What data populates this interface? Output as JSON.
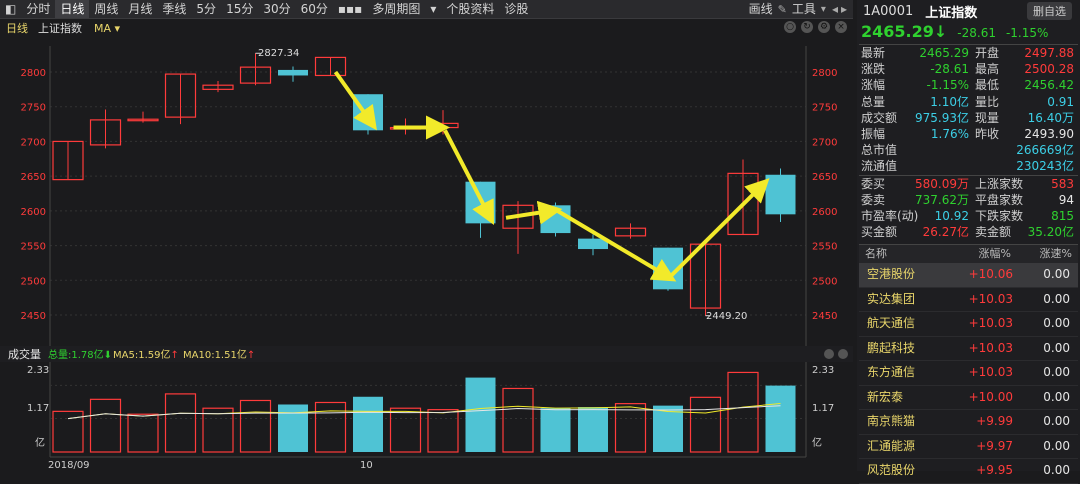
{
  "toolbar": {
    "items": [
      "分时",
      "日线",
      "周线",
      "月线",
      "季线",
      "5分",
      "15分",
      "30分",
      "60分",
      "▪▪▪",
      "多周期图",
      "▾",
      "个股资料",
      "诊股"
    ],
    "active_index": 1,
    "right_items": [
      "画线",
      "工具"
    ]
  },
  "subbar": {
    "label": "日线",
    "name": "上证指数",
    "ma": "MA"
  },
  "price_axis": [
    "2800",
    "2750",
    "2700",
    "2650",
    "2600",
    "2550",
    "2500",
    "2450"
  ],
  "annotations": {
    "high": "2827.34",
    "low": "2449.20"
  },
  "volume": {
    "title": "成交量",
    "total": "总量:1.78亿",
    "ma5": "MA5:1.59亿",
    "ma10": "MA10:1.51亿",
    "axis_top": "2.33",
    "axis_mid": "1.17",
    "axis_unit": "亿"
  },
  "xaxis": {
    "label1": "2018/09",
    "label2": "10"
  },
  "chart_data": {
    "type": "candlestick",
    "ylim": [
      2420,
      2840
    ],
    "candles": [
      {
        "o": 2645,
        "c": 2700,
        "h": 2700,
        "l": 2645
      },
      {
        "o": 2695,
        "c": 2731,
        "h": 2746,
        "l": 2690
      },
      {
        "o": 2730,
        "c": 2732,
        "h": 2743,
        "l": 2727
      },
      {
        "o": 2735,
        "c": 2797,
        "h": 2797,
        "l": 2725
      },
      {
        "o": 2775,
        "c": 2781,
        "h": 2787,
        "l": 2771
      },
      {
        "o": 2784,
        "c": 2807,
        "h": 2827,
        "l": 2781
      },
      {
        "o": 2803,
        "c": 2795,
        "h": 2808,
        "l": 2786
      },
      {
        "o": 2795,
        "c": 2821,
        "h": 2821,
        "l": 2795
      },
      {
        "o": 2768,
        "c": 2716,
        "h": 2768,
        "l": 2710
      },
      {
        "o": 2718,
        "c": 2720,
        "h": 2733,
        "l": 2710
      },
      {
        "o": 2720,
        "c": 2726,
        "h": 2745,
        "l": 2710
      },
      {
        "o": 2642,
        "c": 2582,
        "h": 2642,
        "l": 2561
      },
      {
        "o": 2575,
        "c": 2608,
        "h": 2614,
        "l": 2538
      },
      {
        "o": 2608,
        "c": 2568,
        "h": 2612,
        "l": 2563
      },
      {
        "o": 2560,
        "c": 2545,
        "h": 2566,
        "l": 2536
      },
      {
        "o": 2564,
        "c": 2575,
        "h": 2582,
        "l": 2560
      },
      {
        "o": 2547,
        "c": 2487,
        "h": 2547,
        "l": 2485
      },
      {
        "o": 2460,
        "c": 2552,
        "h": 2552,
        "l": 2449
      },
      {
        "o": 2566,
        "c": 2654,
        "h": 2674,
        "l": 2566
      },
      {
        "o": 2652,
        "c": 2595,
        "h": 2661,
        "l": 2584
      }
    ],
    "volumes": [
      1.42,
      1.84,
      1.32,
      2.03,
      1.53,
      1.8,
      1.66,
      1.73,
      1.93,
      1.53,
      1.48,
      2.6,
      2.22,
      1.53,
      1.57,
      1.69,
      1.62,
      1.91,
      2.78,
      2.32
    ],
    "vol_ylim": [
      0,
      2.9
    ]
  },
  "stock": {
    "code": "1A0001",
    "name": "上证指数",
    "delete_label": "删自选",
    "price": "2465.29",
    "arrow": "↓",
    "change": "-28.61",
    "change_pct": "-1.15%"
  },
  "quote": {
    "row1": [
      "最新",
      "2465.29",
      "开盘",
      "2497.88"
    ],
    "row2": [
      "涨跌",
      "-28.61",
      "最高",
      "2500.28"
    ],
    "row3": [
      "涨幅",
      "-1.15%",
      "最低",
      "2456.42"
    ],
    "row4": [
      "总量",
      "1.10亿",
      "量比",
      "0.91"
    ],
    "row5": [
      "成交额",
      "975.93亿",
      "现量",
      "16.40万"
    ],
    "row6": [
      "振幅",
      "1.76%",
      "昨收",
      "2493.90"
    ],
    "row7": [
      "总市值",
      "266669亿"
    ],
    "row8": [
      "流通值",
      "230243亿"
    ],
    "row9": [
      "委买",
      "580.09万",
      "上涨家数",
      "583"
    ],
    "row10": [
      "委卖",
      "737.62万",
      "平盘家数",
      "94"
    ],
    "row11": [
      "市盈率(动)",
      "10.92",
      "下跌家数",
      "815"
    ],
    "row12": [
      "买金额",
      "26.27亿",
      "卖金额",
      "35.20亿"
    ]
  },
  "list": {
    "headers": [
      "名称",
      "涨幅%",
      "涨速%"
    ],
    "rows": [
      {
        "name": "空港股份",
        "pct": "+10.06",
        "speed": "0.00"
      },
      {
        "name": "实达集团",
        "pct": "+10.03",
        "speed": "0.00"
      },
      {
        "name": "航天通信",
        "pct": "+10.03",
        "speed": "0.00"
      },
      {
        "name": "鹏起科技",
        "pct": "+10.03",
        "speed": "0.00"
      },
      {
        "name": "东方通信",
        "pct": "+10.03",
        "speed": "0.00"
      },
      {
        "name": "新宏泰",
        "pct": "+10.00",
        "speed": "0.00"
      },
      {
        "name": "南京熊猫",
        "pct": "+9.99",
        "speed": "0.00"
      },
      {
        "name": "汇通能源",
        "pct": "+9.97",
        "speed": "0.00"
      },
      {
        "name": "风范股份",
        "pct": "+9.95",
        "speed": "0.00"
      }
    ]
  }
}
